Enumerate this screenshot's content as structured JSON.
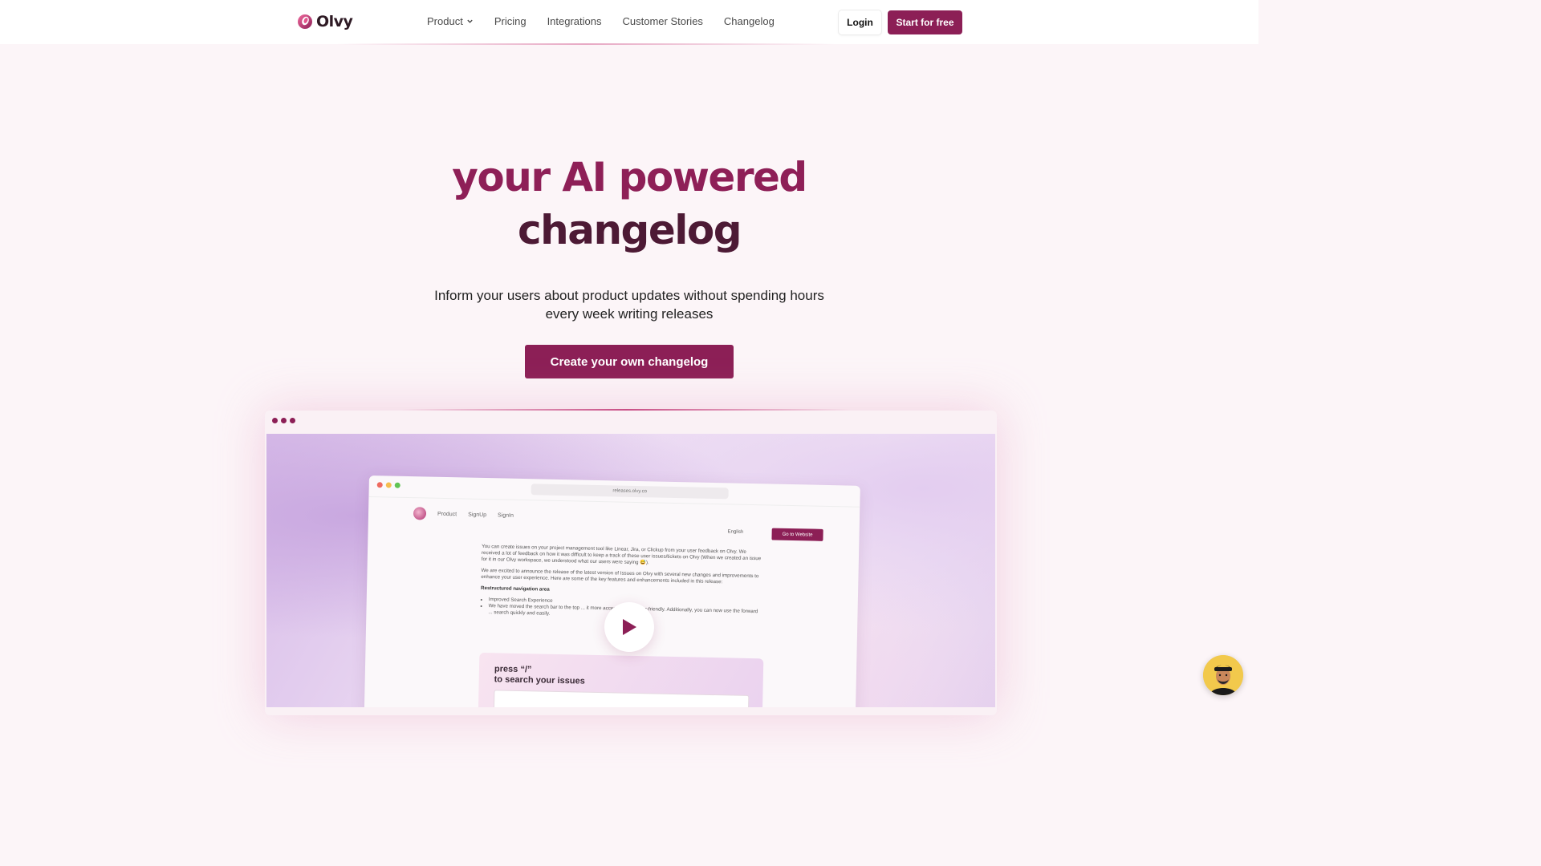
{
  "brand": {
    "name": "Olvy",
    "accent": "#8c1f56"
  },
  "nav": {
    "items": [
      {
        "label": "Product",
        "has_dropdown": true
      },
      {
        "label": "Pricing"
      },
      {
        "label": "Integrations"
      },
      {
        "label": "Customer Stories"
      },
      {
        "label": "Changelog"
      }
    ],
    "login_label": "Login",
    "start_label": "Start for free"
  },
  "hero": {
    "title_line1": "your AI powered",
    "title_line2": "changelog",
    "subtitle": "Inform your users about product updates without spending hours every week writing releases",
    "cta_label": "Create your own changelog"
  },
  "preview": {
    "url": "releases.olvy.co",
    "nav_items": [
      "Product",
      "SignUp",
      "SignIn"
    ],
    "language": "English",
    "goto_label": "Go to Website",
    "para1": "You can create issues on your project management tool like Linear, Jira, or Clickup from your user feedback on Olvy. We received a lot of feedback on how it was difficult to keep a track of these user issues/tickets on Olvy (When we created an issue for it in our Olvy workspace, we understood what our users were saying 😅).",
    "para2": "We are excited to announce the release of the latest version of Issues on Olvy with several new changes and improvements to enhance your user experience. Here are some of the key features and enhancements included in this release:",
    "section_heading": "Restructured navigation area",
    "bullet1": "Improved Search Experience",
    "bullet2": "We have moved the search bar to the top ... it more accessible and user-friendly. Additionally, you can now use the forward ... search quickly and easily.",
    "card_line1": "press “/”",
    "card_line2": "to search your issues"
  },
  "icons": {
    "logo": "olvy-logo-icon",
    "dropdown": "chevron-down-icon",
    "play": "play-icon",
    "chat": "chat-avatar"
  }
}
